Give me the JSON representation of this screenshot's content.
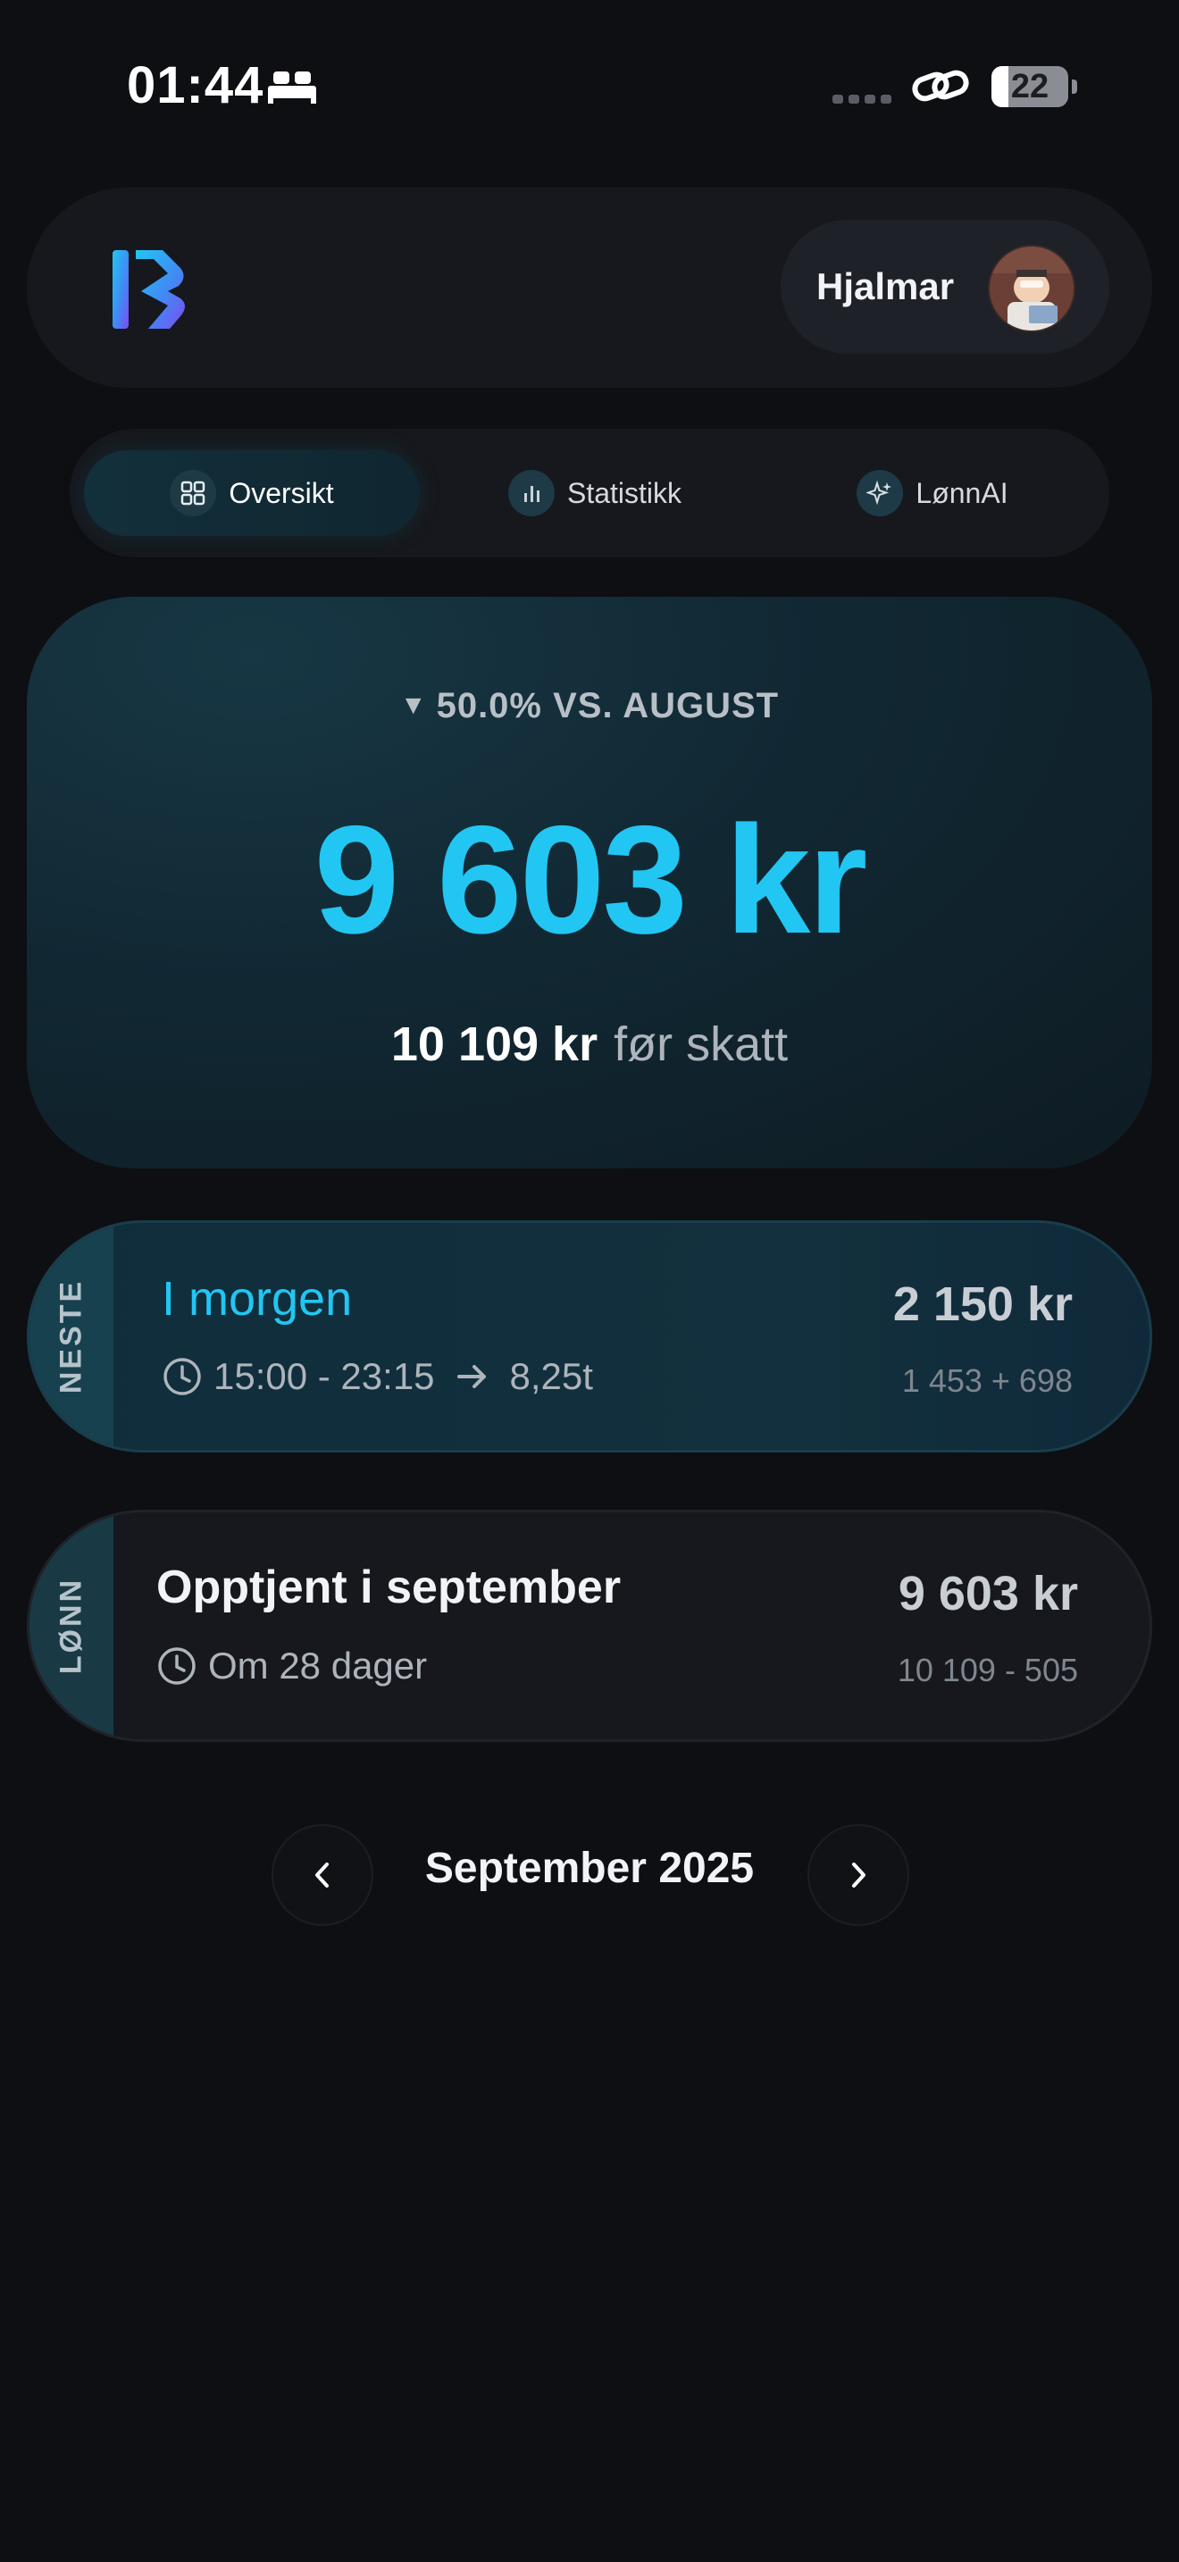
{
  "status_bar": {
    "time": "01:44",
    "battery": "22",
    "battery_level": 0.22
  },
  "header": {
    "user_name": "Hjalmar",
    "logo_icon": "k-logo-icon",
    "avatar_icon": "user-avatar"
  },
  "tabs": [
    {
      "label": "Oversikt",
      "icon": "grid-icon",
      "active": true
    },
    {
      "label": "Statistikk",
      "icon": "bar-chart-icon",
      "active": false
    },
    {
      "label": "LønnAI",
      "icon": "sparkle-icon",
      "active": false
    }
  ],
  "summary": {
    "change": "50.0% VS. AUGUST",
    "change_arrow": "▼",
    "net_amount": "9 603 kr",
    "gross_amount": "10 109 kr",
    "gross_label": "før skatt"
  },
  "next_card": {
    "side_label": "NESTE",
    "title": "I morgen",
    "time_range": "15:00 - 23:15",
    "hours": "8,25t",
    "amount": "2 150 kr",
    "breakdown": "1 453 + 698"
  },
  "pay_card": {
    "side_label": "LØNN",
    "title": "Opptjent i september",
    "subtitle": "Om 28 dager",
    "amount": "9 603 kr",
    "breakdown": "10 109 - 505"
  },
  "month_nav": {
    "label": "September 2025"
  },
  "colors": {
    "accent": "#22c6f2",
    "background": "#0d0f13",
    "card": "#16181d"
  }
}
